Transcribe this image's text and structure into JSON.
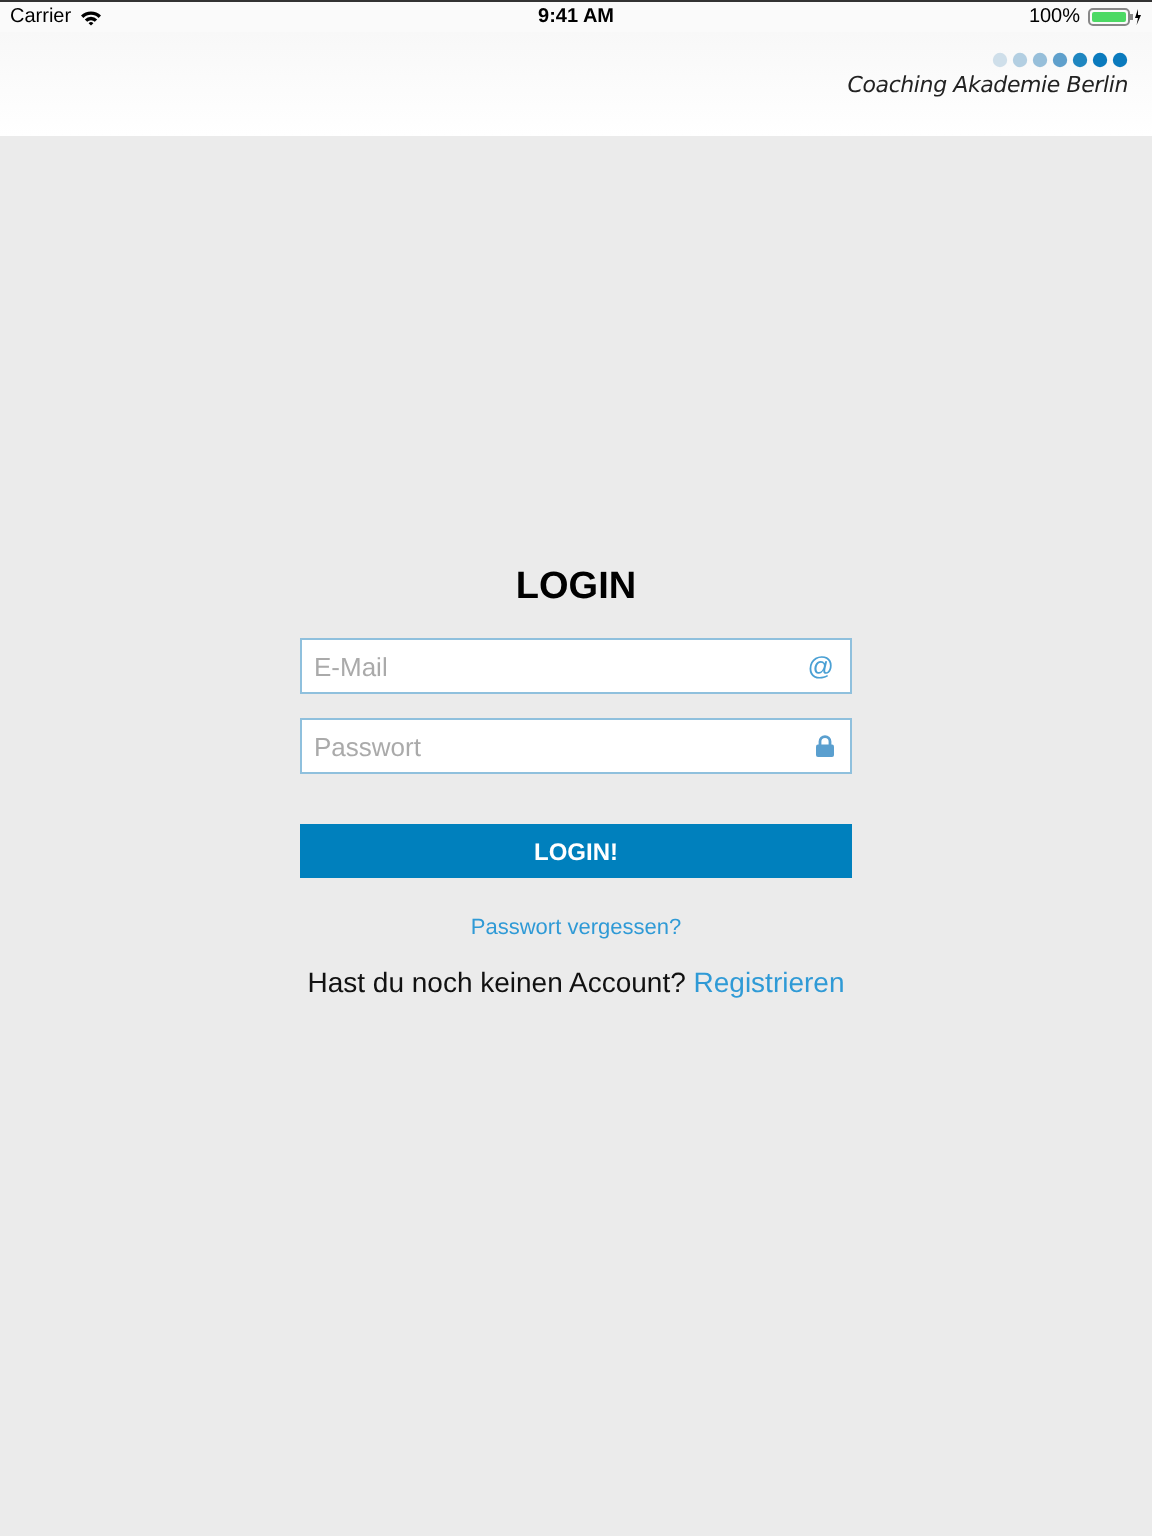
{
  "status_bar": {
    "carrier": "Carrier",
    "time": "9:41 AM",
    "battery": "100%"
  },
  "header": {
    "logo_text": "Coaching Akademie Berlin"
  },
  "login": {
    "title": "LOGIN",
    "fields": [
      {
        "kind": "email",
        "placeholder": "E-Mail",
        "icon": "@"
      },
      {
        "kind": "password",
        "placeholder": "Passwort"
      }
    ],
    "button": "LOGIN!",
    "forgot_link": "Passwort vergessen?",
    "register_prompt": "Hast du noch keinen Account?",
    "register_link": "Registrieren"
  }
}
